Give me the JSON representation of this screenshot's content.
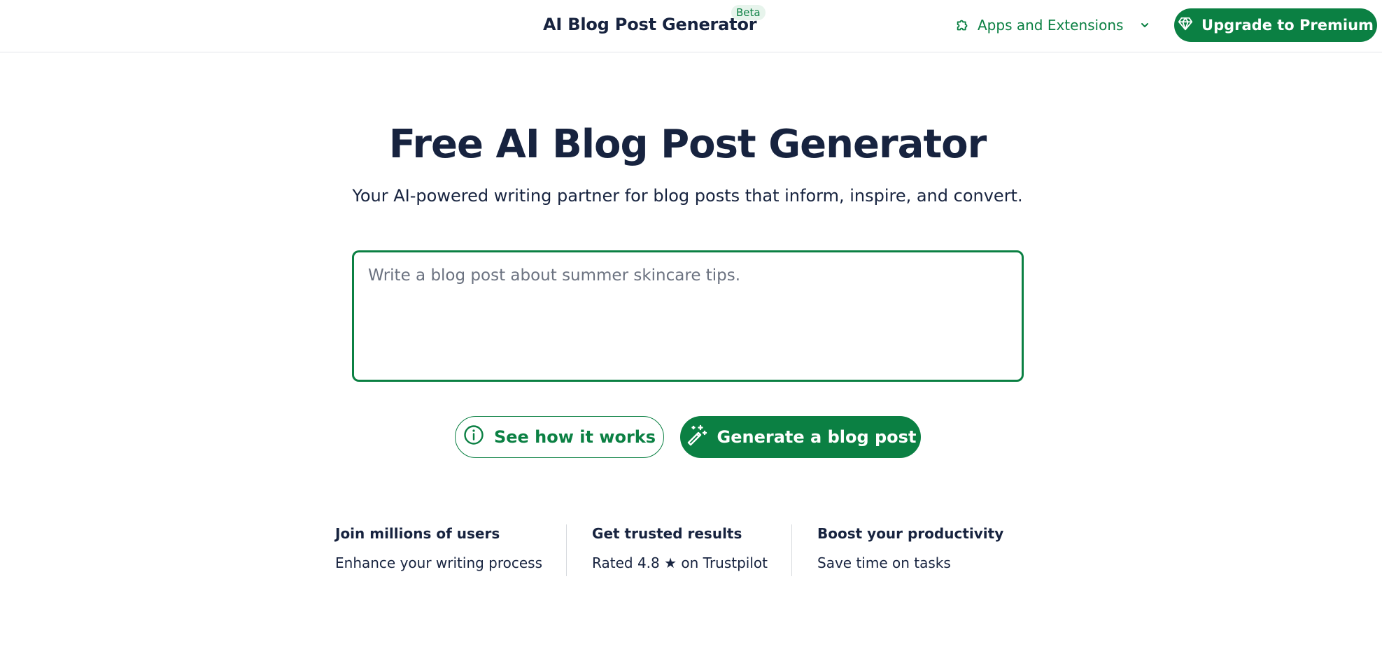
{
  "header": {
    "brand": "AI Blog Post Generator",
    "badge": "Beta",
    "apps_label": "Apps and Extensions",
    "premium_label": "Upgrade to Premium"
  },
  "hero": {
    "title": "Free AI Blog Post Generator",
    "subtitle": "Your AI-powered writing partner for blog posts that inform, inspire, and convert."
  },
  "prompt": {
    "placeholder": "Write a blog post about summer skincare tips.",
    "value": ""
  },
  "actions": {
    "how_label": "See how it works",
    "generate_label": "Generate a blog post"
  },
  "features": [
    {
      "title": "Join millions of users",
      "text": "Enhance your writing process"
    },
    {
      "title": "Get trusted results",
      "text": "Rated 4.8 ★ on Trustpilot"
    },
    {
      "title": "Boost your productivity",
      "text": "Save time on tasks"
    }
  ],
  "icons": {
    "apps": "puzzle-icon",
    "apps_caret": "chevron-down-icon",
    "premium": "diamond-icon",
    "how": "info-icon",
    "generate": "magic-wand-icon"
  },
  "colors": {
    "brand_green": "#0b8043",
    "text_dark": "#17233f",
    "badge_bg": "#e7f4ec",
    "divider": "#e3e5e9"
  }
}
